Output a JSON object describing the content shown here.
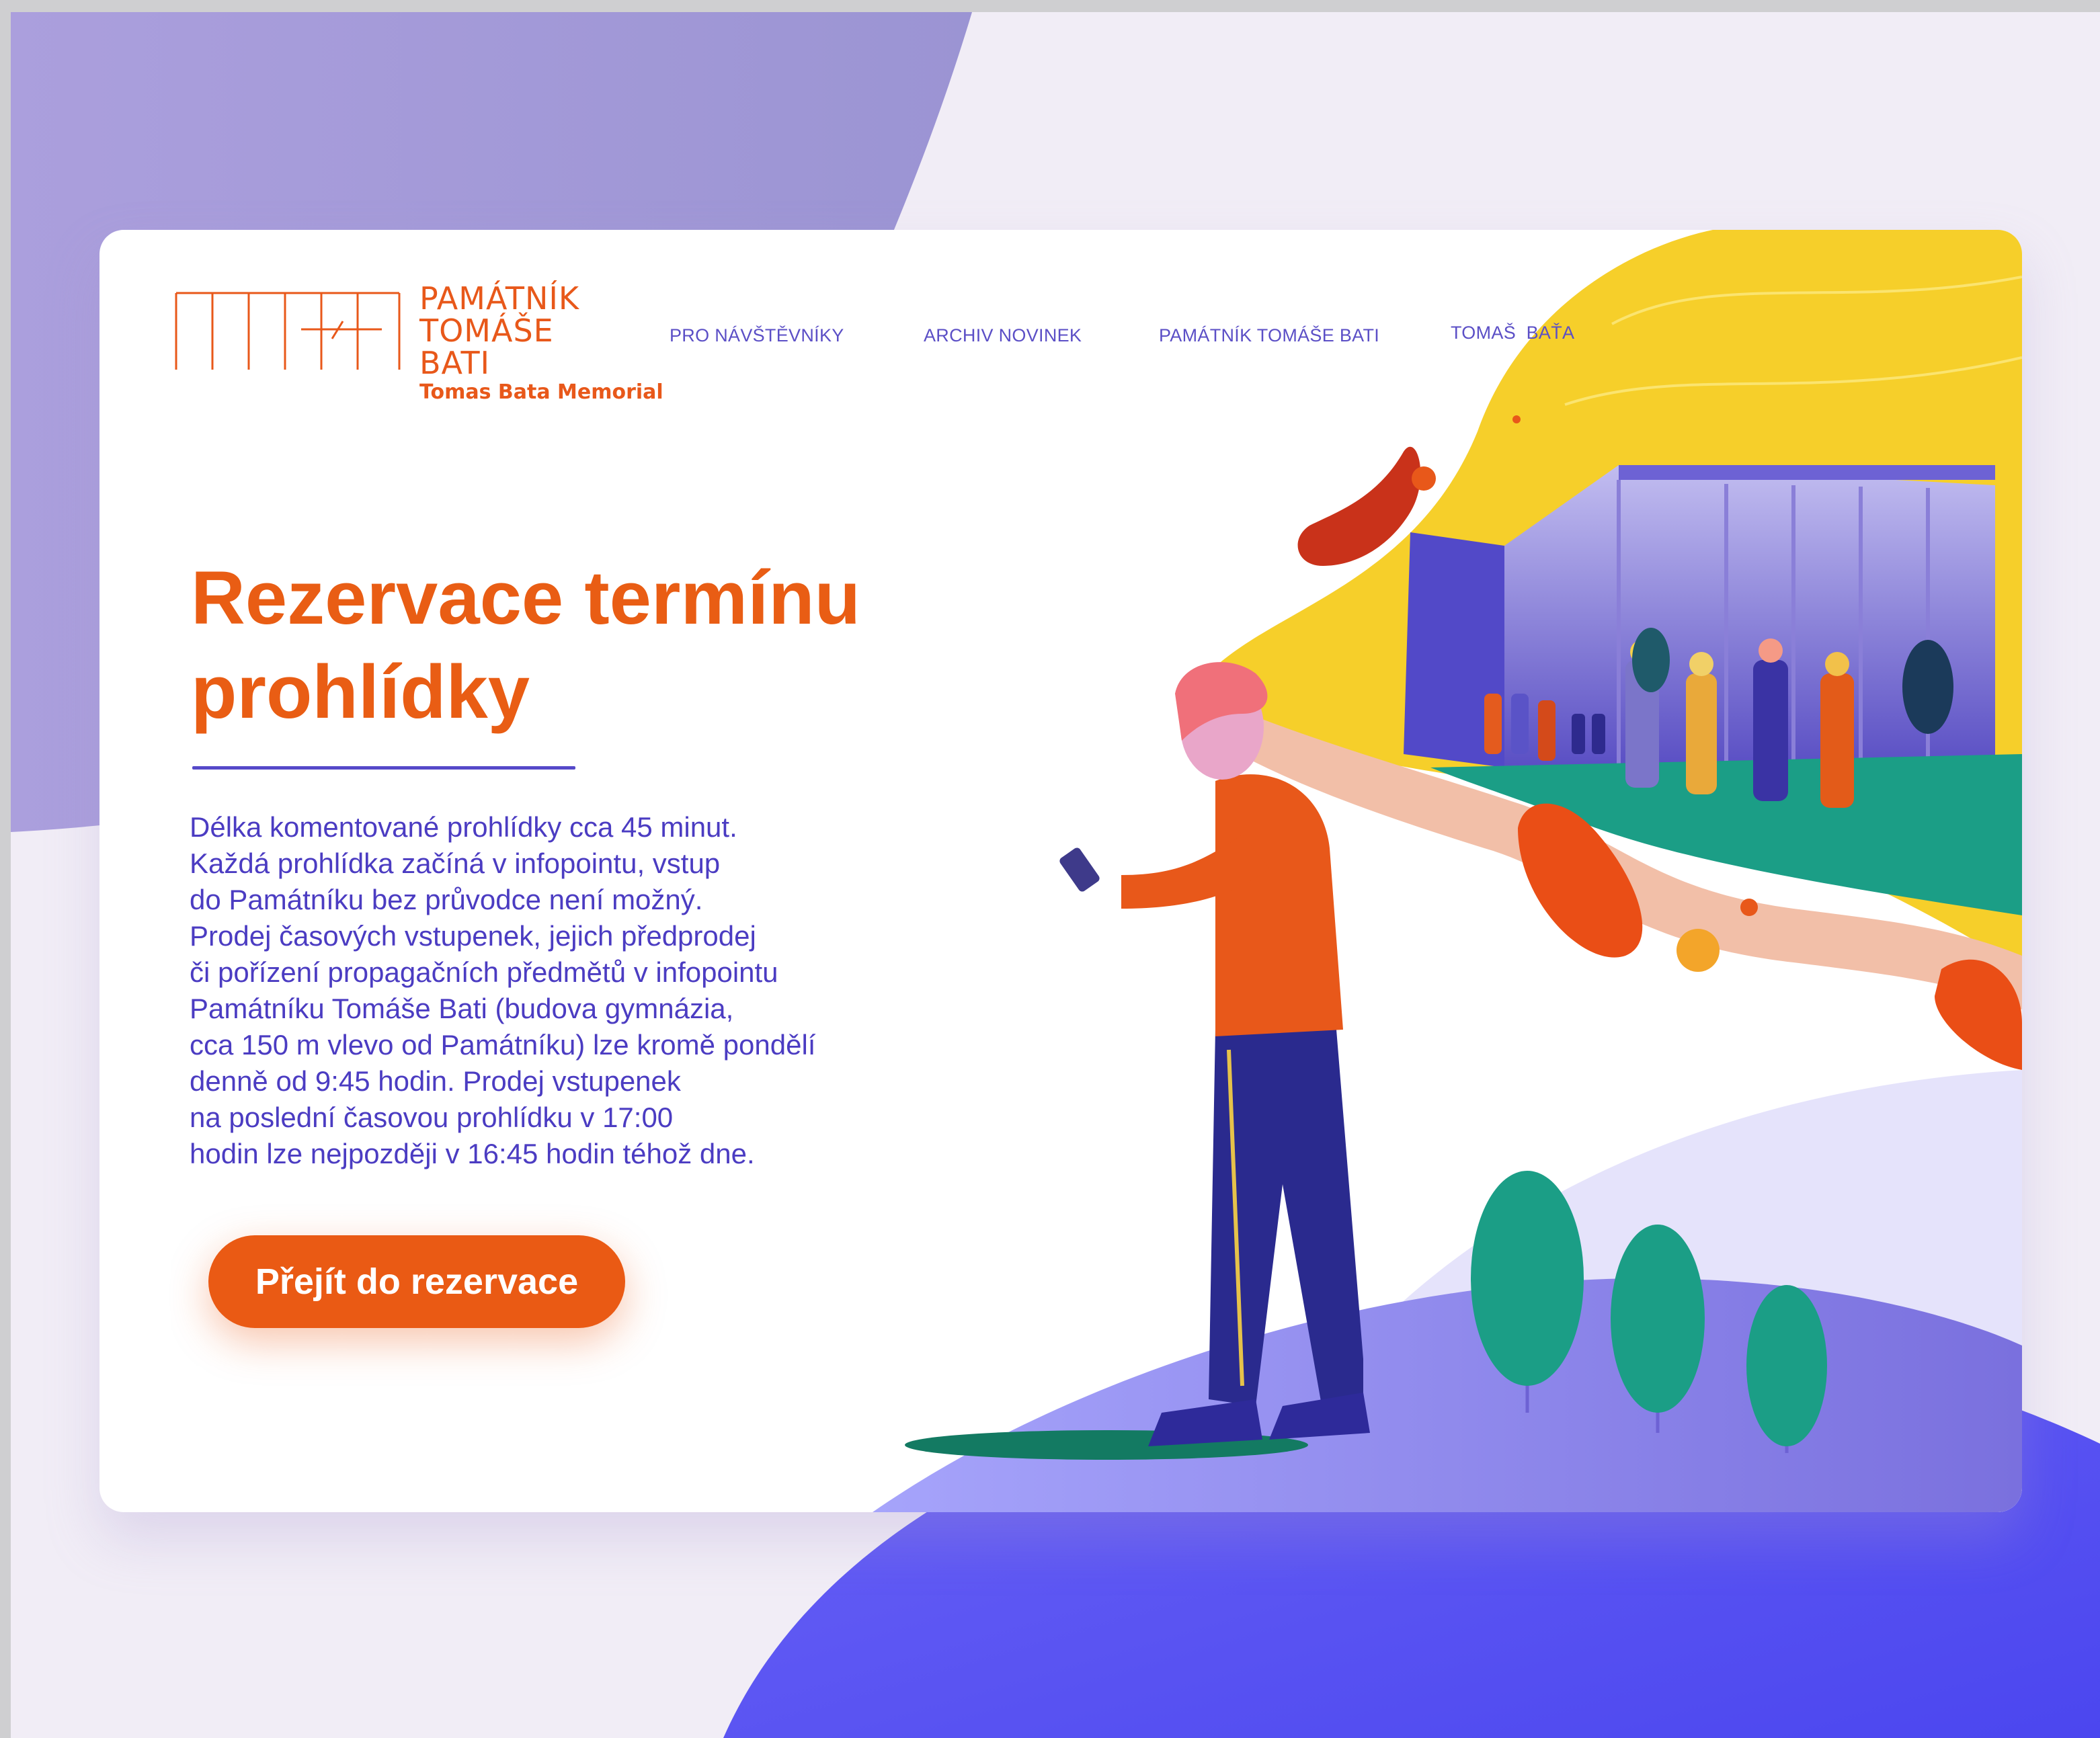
{
  "logo": {
    "name_lines": [
      "PAMÁTNÍK",
      "TOMÁŠE",
      "BATI"
    ],
    "subtitle": "Tomas Bata Memorial"
  },
  "nav": {
    "items": [
      {
        "label": "PRO NÁVŠTĚVNÍKY"
      },
      {
        "label": "ARCHIV NOVINEK"
      },
      {
        "label": "PAMÁTNÍK TOMÁŠE BATI"
      },
      {
        "label": "TOMAŠ  BAŤA"
      }
    ]
  },
  "hero": {
    "title_lines": [
      "Rezervace termínu",
      "prohlídky"
    ],
    "description_lines": [
      "Délka komentované prohlídky cca 45 minut.",
      "Každá prohlídka začíná v infopointu, vstup",
      "do Památníku bez průvodce není možný.",
      "Prodej časových vstupenek, jejich předprodej",
      "či pořízení propagačních předmětů v infopointu",
      "Památníku Tomáše Bati (budova gymnázia,",
      "cca 150 m vlevo od Památníku) lze kromě pondělí",
      "denně od 9:45 hodin. Prodej vstupenek",
      "na poslední časovou prohlídku v 17:00",
      "hodin lze nejpozději v 16:45 hodin téhož dne."
    ],
    "cta_label": "Přejít do rezervace"
  },
  "colors": {
    "accent": "#e95d14",
    "text_primary": "#4b3cc2",
    "purple_bg": "#a399d9",
    "deep_purple": "#5d56f3",
    "yellow": "#f6cf2a",
    "teal": "#1a9d86"
  }
}
